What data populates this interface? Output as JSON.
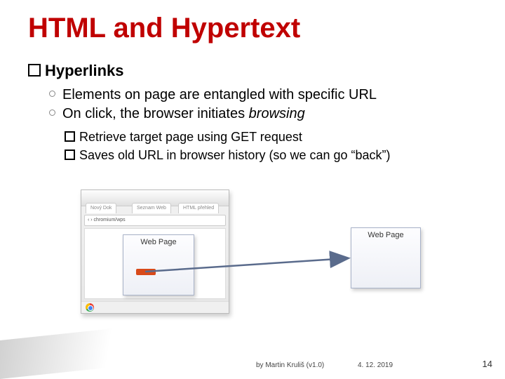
{
  "title": "HTML and Hypertext",
  "section": "Hyperlinks",
  "bullet1": "Elements on page are entangled with specific URL",
  "bullet2a": "On click, the browser initiates ",
  "bullet2b": "browsing",
  "sub1": "Retrieve target page using GET request",
  "sub2": "Saves old URL in browser history (so we can go “back”)",
  "browser": {
    "tab1": "Nový Dok",
    "tab2": "Seznam Web",
    "tab3": "HTML přehled",
    "addr": "‹ ›  chromium/wps"
  },
  "webpage_label": "Web Page",
  "footer": {
    "author": "by Martin Kruliš (v1.0)",
    "date": "4. 12. 2019",
    "page": "14"
  }
}
